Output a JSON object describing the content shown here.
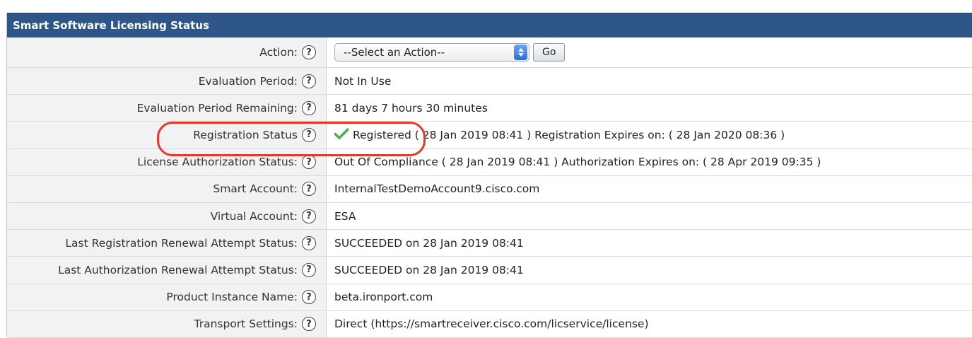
{
  "panel": {
    "title": "Smart Software Licensing Status"
  },
  "help_glyph": "?",
  "action_row": {
    "label": "Action:",
    "select_value": "--Select an Action--",
    "go_label": "Go"
  },
  "rows": [
    {
      "label": "Evaluation Period:",
      "value": "Not In Use"
    },
    {
      "label": "Evaluation Period Remaining:",
      "value": "81 days 7 hours 30 minutes"
    },
    {
      "label": "Registration Status",
      "status": "Registered",
      "value": " ( 28 Jan 2019 08:41 ) Registration Expires on: ( 28 Jan 2020 08:36 )"
    },
    {
      "label": "License Authorization Status:",
      "value": "Out Of Compliance ( 28 Jan 2019 08:41 ) Authorization Expires on: ( 28 Apr 2019 09:35 )"
    },
    {
      "label": "Smart Account:",
      "value": "InternalTestDemoAccount9.cisco.com"
    },
    {
      "label": "Virtual Account:",
      "value": "ESA"
    },
    {
      "label": "Last Registration Renewal Attempt Status:",
      "value": "SUCCEEDED on 28 Jan 2019 08:41"
    },
    {
      "label": "Last Authorization Renewal Attempt Status:",
      "value": "SUCCEEDED on 28 Jan 2019 08:41"
    },
    {
      "label": "Product Instance Name:",
      "value": "beta.ironport.com"
    },
    {
      "label": "Transport Settings:",
      "value": "Direct (https://smartreceiver.cisco.com/licservice/license)"
    }
  ],
  "colors": {
    "header_bg": "#2f5688",
    "label_bg": "#f2f2f2",
    "check_green": "#4caf50",
    "highlight_red": "#e33a2c"
  },
  "icons": {
    "help": "question-circle-icon",
    "registered": "checkmark-icon",
    "select_arrows": "up-down-arrows-icon"
  }
}
